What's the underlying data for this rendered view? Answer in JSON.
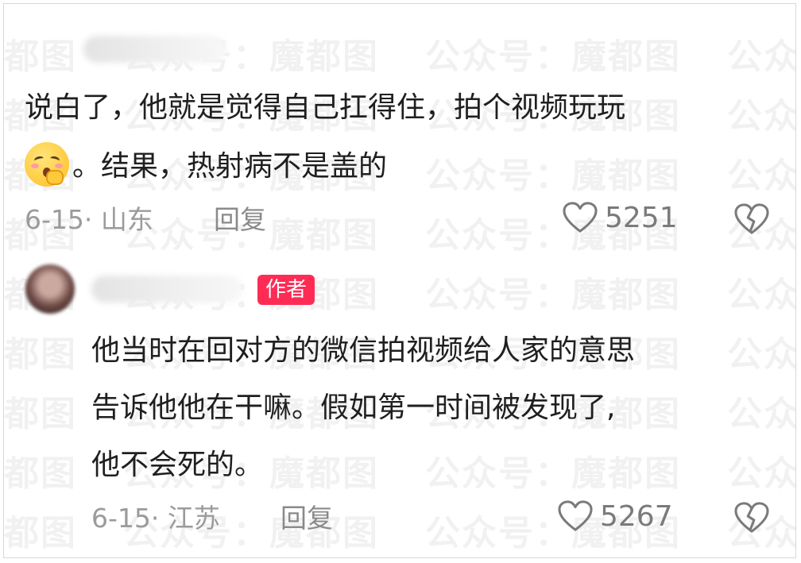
{
  "watermark": {
    "text": "公众号：魔都图"
  },
  "comments": [
    {
      "username": "",
      "text_lines": [
        "说白了，他就是觉得自己扛得住，拍个视频玩玩",
        "。结果，热射病不是盖的"
      ],
      "emoji": "yawning-face-emoji",
      "date_location": "6-15· 山东",
      "reply_label": "回复",
      "likes": "5251"
    },
    {
      "username": "",
      "author_badge": "作者",
      "text_lines": [
        "他当时在回对方的微信拍视频给人家的意思",
        "告诉他他在干嘛。假如第一时间被发现了,",
        "他不会死的。"
      ],
      "date_location": "6-15· 江苏",
      "reply_label": "回复",
      "likes": "5267"
    }
  ],
  "colors": {
    "badge": "#fe2c55",
    "meta": "#9b9b9b",
    "text": "#1f1f1f"
  },
  "icons": {
    "like": "heart-outline-icon",
    "dislike": "broken-heart-icon"
  }
}
